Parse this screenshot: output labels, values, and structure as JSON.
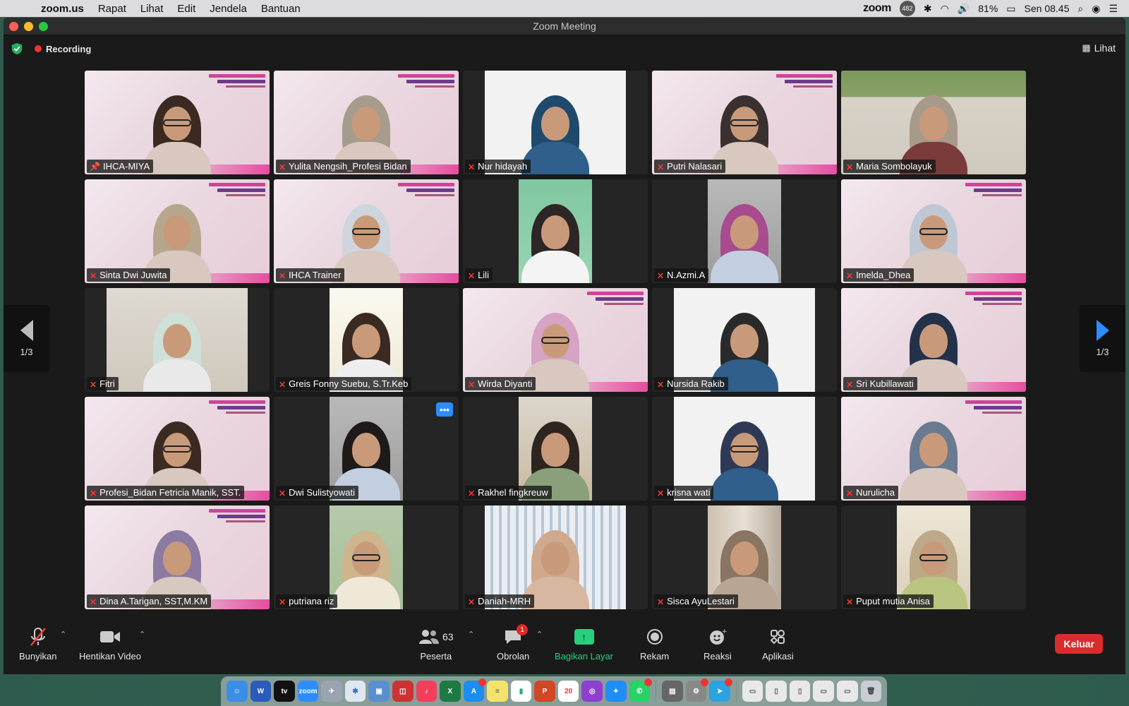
{
  "menubar": {
    "app_name": "zoom.us",
    "menus": [
      "Rapat",
      "Lihat",
      "Edit",
      "Jendela",
      "Bantuan"
    ],
    "status_zoom": "zoom",
    "status_zoom_badge": "482",
    "battery": "81%",
    "clock": "Sen 08.45"
  },
  "window": {
    "title": "Zoom Meeting"
  },
  "topbar": {
    "recording_label": "Recording",
    "view_label": "Lihat"
  },
  "gallery": {
    "page_left": "1/3",
    "page_right": "1/3",
    "participants": [
      {
        "name": "IHCA-MIYA",
        "bg": "banner",
        "active": true,
        "pinned": true
      },
      {
        "name": "Yulita Nengsih_Profesi Bidan",
        "bg": "banner"
      },
      {
        "name": "Nur hidayah",
        "bg": "white"
      },
      {
        "name": "Putri Nalasari",
        "bg": "banner"
      },
      {
        "name": "Maria Sombolayuk",
        "bg": "shelf"
      },
      {
        "name": "Sinta Dwi Juwita",
        "bg": "banner"
      },
      {
        "name": "IHCA Trainer",
        "bg": "banner"
      },
      {
        "name": "Lili",
        "bg": "green"
      },
      {
        "name": "N.Azmi.A",
        "bg": "gray"
      },
      {
        "name": "Imelda_Dhea",
        "bg": "banner"
      },
      {
        "name": "Fitri",
        "bg": "room"
      },
      {
        "name": "Greis Fonny Suebu, S.Tr.Keb",
        "bg": "lightwall"
      },
      {
        "name": "Wirda Diyanti",
        "bg": "banner"
      },
      {
        "name": "Nursida Rakib",
        "bg": "white"
      },
      {
        "name": "Sri Kubillawati",
        "bg": "banner"
      },
      {
        "name": "Profesi_Bidan Fetricia Manik, SST.",
        "bg": "banner"
      },
      {
        "name": "Dwi Sulistyowati",
        "bg": "gray",
        "more": true
      },
      {
        "name": "Rakhel fingkreuw",
        "bg": "wood"
      },
      {
        "name": "krisna wati",
        "bg": "white"
      },
      {
        "name": "Nurulicha",
        "bg": "banner"
      },
      {
        "name": "Dina A.Tarigan, SST,M.KM",
        "bg": "banner"
      },
      {
        "name": "putriana riz",
        "bg": "greenwall"
      },
      {
        "name": "Daniah-MRH",
        "bg": "stripe"
      },
      {
        "name": "Sisca AyuLestari",
        "bg": "blur"
      },
      {
        "name": "Puput mutia Anisa",
        "bg": "cream"
      }
    ]
  },
  "toolbar": {
    "mute_label": "Bunyikan",
    "video_label": "Hentikan Video",
    "participants_label": "Peserta",
    "participants_count": "63",
    "chat_label": "Obrolan",
    "chat_badge": "1",
    "share_label": "Bagikan Layar",
    "record_label": "Rekam",
    "reactions_label": "Reaksi",
    "apps_label": "Aplikasi",
    "leave_label": "Keluar"
  },
  "dock": {
    "calendar_day": "20"
  },
  "colors": {
    "accent_blue": "#2d8cff",
    "share_green": "#26d07c",
    "leave_red": "#d92d2d",
    "active_speaker": "#34c759"
  }
}
